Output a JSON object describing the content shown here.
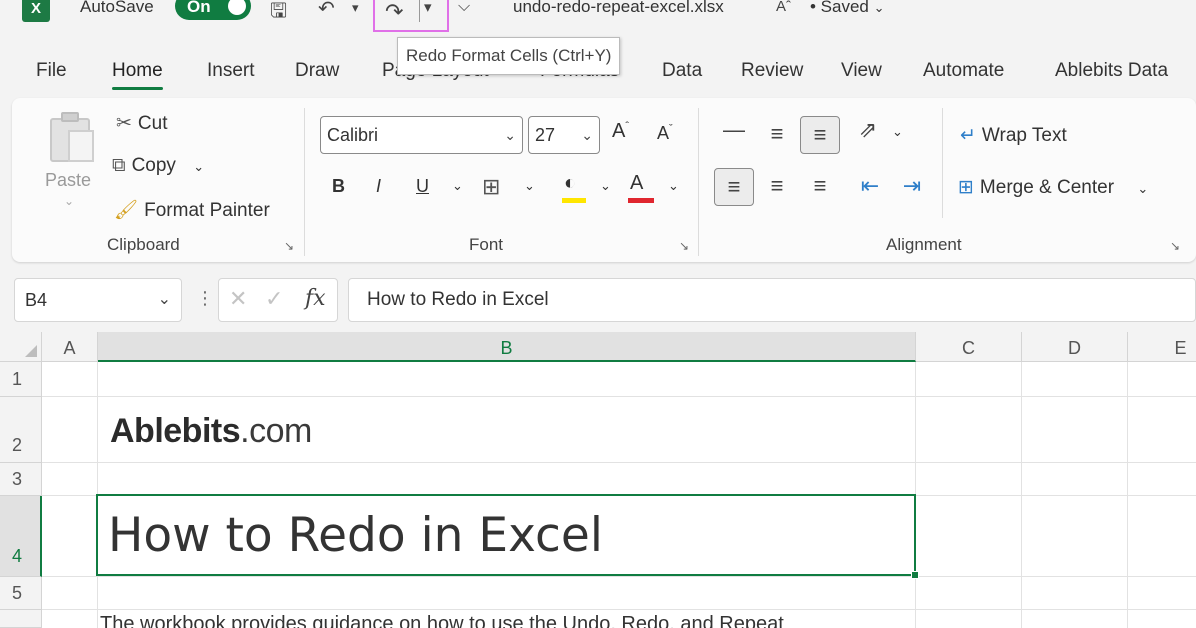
{
  "titlebar": {
    "app_icon": "X",
    "autosave_label": "AutoSave",
    "autosave_state": "On",
    "filename": "undo-redo-repeat-excel.xlsx",
    "saved_status": "• Saved"
  },
  "tooltip": {
    "text": "Redo Format Cells (Ctrl+Y)"
  },
  "tabs": [
    "File",
    "Home",
    "Insert",
    "Draw",
    "Page Layout",
    "Formulas",
    "Data",
    "Review",
    "View",
    "Automate",
    "Ablebits Data"
  ],
  "ribbon": {
    "clipboard": {
      "paste": "Paste",
      "cut": "Cut",
      "copy": "Copy",
      "format_painter": "Format Painter",
      "label": "Clipboard"
    },
    "font": {
      "font_name": "Calibri",
      "font_size": "27",
      "bold": "B",
      "italic": "I",
      "underline": "U",
      "grow": "A",
      "shrink": "A",
      "font_color_letter": "A",
      "label": "Font",
      "highlight_color": "#ffe600",
      "font_color": "#e0262f"
    },
    "alignment": {
      "wrap_text": "Wrap Text",
      "merge_center": "Merge & Center",
      "label": "Alignment"
    }
  },
  "formula_bar": {
    "name_box": "B4",
    "fx": "fx",
    "value": "How to Redo in Excel"
  },
  "sheet": {
    "columns": [
      "A",
      "B",
      "C",
      "D",
      "E"
    ],
    "rows": [
      "1",
      "2",
      "3",
      "4",
      "5"
    ],
    "logo_main": "Ablebits",
    "logo_domain": ".com",
    "b4": "How to Redo in Excel",
    "b6": "The workbook provides guidance on how to use the Undo, Redo, and Repeat"
  },
  "colors": {
    "accent": "#107c41",
    "tooltip_highlight": "#e070e8"
  }
}
